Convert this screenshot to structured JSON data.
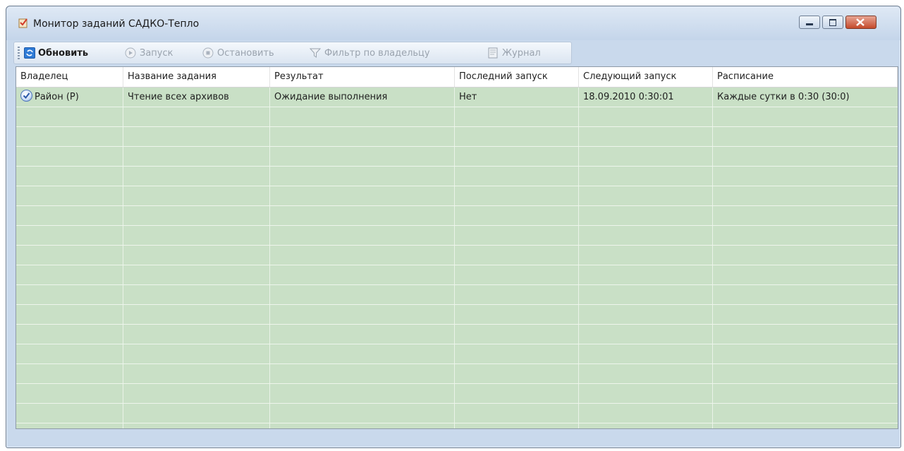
{
  "window": {
    "title": "Монитор заданий САДКО-Тепло"
  },
  "toolbar": {
    "refresh": "Обновить",
    "start": "Запуск",
    "stop": "Остановить",
    "filter": "Фильтр по владельцу",
    "journal": "Журнал"
  },
  "table": {
    "headers": [
      "Владелец",
      "Название задания",
      "Результат",
      "Последний запуск",
      "Следующий запуск",
      "Расписание"
    ],
    "rows": [
      [
        "Район (Р)",
        "Чтение всех архивов",
        "Ожидание выполнения",
        "Нет",
        "18.09.2010 0:30:01",
        "Каждые  сутки в 0:30 (30:0)"
      ]
    ]
  },
  "colors": {
    "grid_background": "#c9e0c6",
    "titlebar": "#c9d9ec",
    "close_button": "#c44a2b"
  }
}
